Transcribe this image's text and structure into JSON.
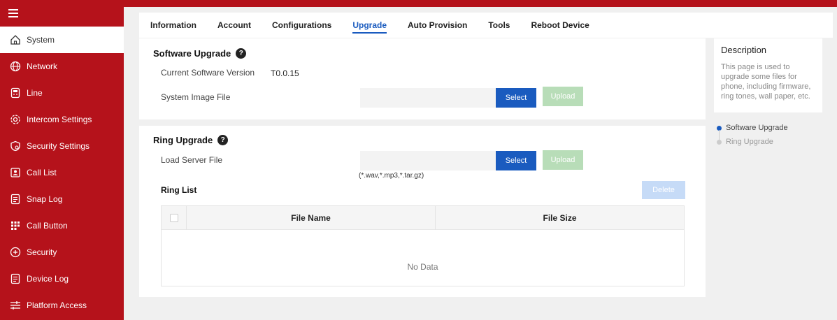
{
  "sidebar": {
    "items": [
      {
        "label": "System",
        "icon": "home-icon",
        "active": true
      },
      {
        "label": "Network",
        "icon": "globe-icon"
      },
      {
        "label": "Line",
        "icon": "phone-icon"
      },
      {
        "label": "Intercom Settings",
        "icon": "gear-icon"
      },
      {
        "label": "Security Settings",
        "icon": "shield-gear-icon"
      },
      {
        "label": "Call List",
        "icon": "contact-card-icon"
      },
      {
        "label": "Snap Log",
        "icon": "document-icon"
      },
      {
        "label": "Call Button",
        "icon": "keypad-icon"
      },
      {
        "label": "Security",
        "icon": "shield-plus-icon"
      },
      {
        "label": "Device Log",
        "icon": "log-icon"
      },
      {
        "label": "Platform Access",
        "icon": "sliders-icon"
      }
    ]
  },
  "tabs": [
    {
      "label": "Information"
    },
    {
      "label": "Account"
    },
    {
      "label": "Configurations"
    },
    {
      "label": "Upgrade",
      "active": true
    },
    {
      "label": "Auto Provision"
    },
    {
      "label": "Tools"
    },
    {
      "label": "Reboot Device"
    }
  ],
  "software_upgrade": {
    "title": "Software Upgrade",
    "current_version_label": "Current Software Version",
    "current_version_value": "T0.0.15",
    "image_file_label": "System Image File",
    "select_label": "Select",
    "upload_label": "Upload"
  },
  "ring_upgrade": {
    "title": "Ring Upgrade",
    "load_file_label": "Load Server File",
    "select_label": "Select",
    "upload_label": "Upload",
    "file_hint": "(*.wav,*.mp3,*.tar.gz)",
    "ring_list_label": "Ring List",
    "delete_label": "Delete",
    "table": {
      "columns": [
        "File Name",
        "File Size"
      ],
      "empty_text": "No Data"
    }
  },
  "description": {
    "title": "Description",
    "text": "This page is used to upgrade some files for phone, including firmware, ring tones, wall paper, etc."
  },
  "anchors": [
    {
      "label": "Software Upgrade",
      "active": true
    },
    {
      "label": "Ring Upgrade"
    }
  ],
  "colors": {
    "brand_red": "#b5121b",
    "accent_blue": "#1a5bbf",
    "upload_green_disabled": "#b8ddb8",
    "delete_blue_disabled": "#c6dbf7"
  }
}
